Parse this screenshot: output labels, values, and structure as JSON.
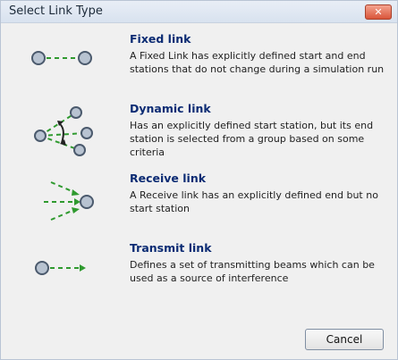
{
  "window": {
    "title": "Select Link Type",
    "close_label": "✕"
  },
  "options": [
    {
      "title": "Fixed link",
      "description": "A Fixed Link has explicitly defined start and end stations that do not change during a simulation run",
      "icon": "fixed-link-icon"
    },
    {
      "title": "Dynamic link",
      "description": "Has an explicitly defined start station, but its end station is selected from a group based on some criteria",
      "icon": "dynamic-link-icon"
    },
    {
      "title": "Receive link",
      "description": "A Receive link has an explicitly defined end but no start station",
      "icon": "receive-link-icon"
    },
    {
      "title": "Transmit link",
      "description": "Defines a set of transmitting beams which can be used as a source of interference",
      "icon": "transmit-link-icon"
    }
  ],
  "buttons": {
    "cancel_label": "Cancel"
  },
  "colors": {
    "link_green": "#2f9a2f",
    "station_gray": "#7d8c9f",
    "title_blue": "#0b2b73"
  }
}
